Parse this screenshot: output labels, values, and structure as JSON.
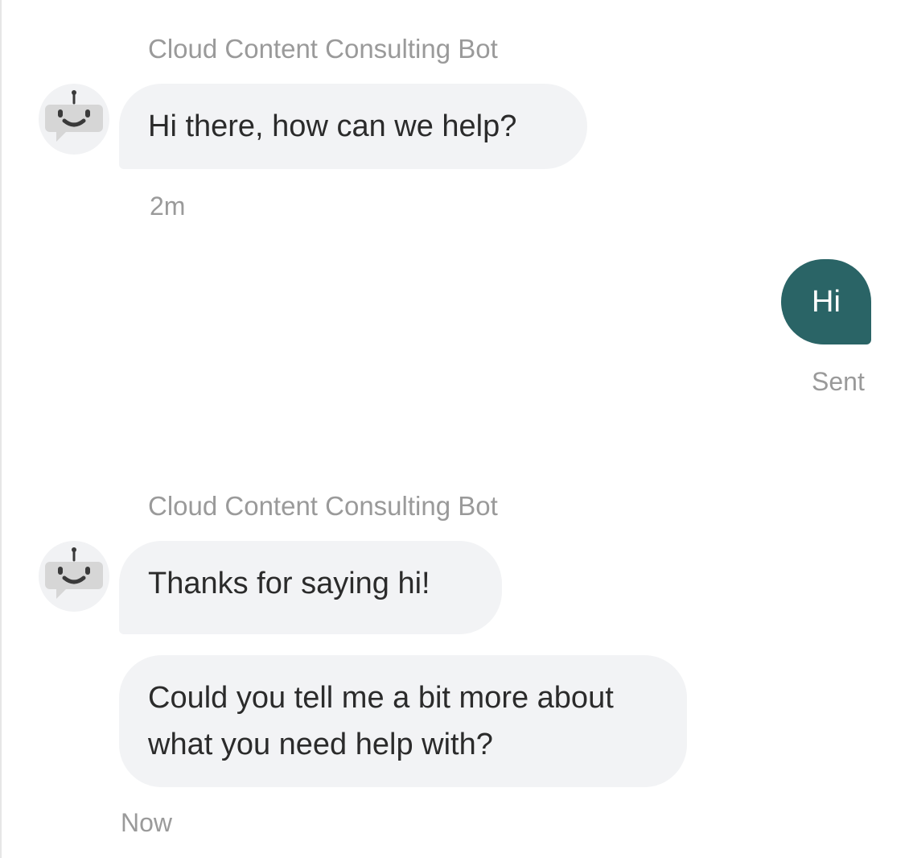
{
  "conversation": {
    "messages": [
      {
        "sender": "Cloud Content Consulting Bot",
        "text": "Hi there, how can we help?",
        "time": "2m"
      },
      {
        "sender": "user",
        "text": "Hi",
        "status": "Sent"
      },
      {
        "sender": "Cloud Content Consulting Bot",
        "texts": [
          "Thanks for saying hi!",
          "Could you tell me a bit more about what you need help with?"
        ],
        "time": "Now"
      }
    ]
  },
  "bot": {
    "name": "Cloud Content Consulting Bot",
    "avatar_icon": "robot-chat-icon"
  },
  "colors": {
    "user_bubble": "#2a6466",
    "bot_bubble": "#f2f3f5",
    "meta_text": "#9a9a9a"
  }
}
